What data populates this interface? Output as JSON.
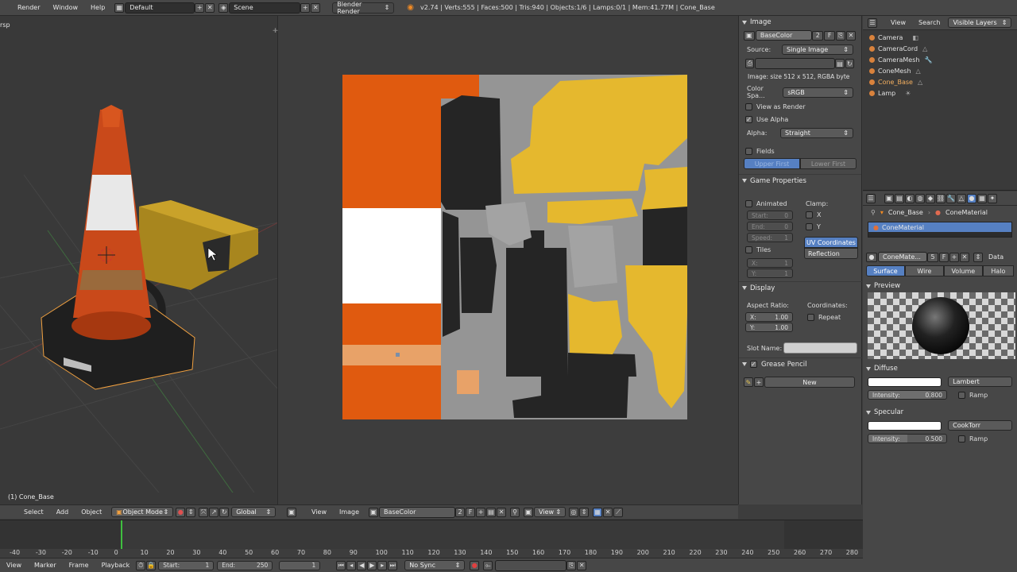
{
  "topbar": {
    "menus": [
      "Render",
      "Window",
      "Help"
    ],
    "layout": "Default",
    "scene": "Scene",
    "engine": "Blender Render",
    "stats": "v2.74 | Verts:555 | Faces:500 | Tris:940 | Objects:1/6 | Lamps:0/1 | Mem:41.77M | Cone_Base"
  },
  "view3d": {
    "corner_label": "rsp",
    "object_label": "(1) Cone_Base"
  },
  "view3d_header": {
    "menus": [
      "Select",
      "Add",
      "Object"
    ],
    "mode": "Object Mode",
    "orientation": "Global"
  },
  "image_header": {
    "menus": [
      "View",
      "Image"
    ],
    "image_name": "BaseColor",
    "users": "2",
    "fake": "F",
    "view": "View"
  },
  "image_panel": {
    "title": "Image",
    "image_name": "BaseColor",
    "users": "2",
    "fake": "F",
    "source_label": "Source:",
    "source_value": "Single Image",
    "info": "Image: size 512 x 512, RGBA byte",
    "colorspace_label": "Color Spa...",
    "colorspace_value": "sRGB",
    "view_as_render": "View as Render",
    "use_alpha": "Use Alpha",
    "alpha_label": "Alpha:",
    "alpha_value": "Straight",
    "fields": "Fields",
    "upper_first": "Upper First",
    "lower_first": "Lower First"
  },
  "game_panel": {
    "title": "Game Properties",
    "animated": "Animated",
    "clamp": "Clamp:",
    "start_label": "Start:",
    "start_val": "0",
    "end_label": "End:",
    "end_val": "0",
    "speed_label": "Speed:",
    "speed_val": "1",
    "clamp_x": "X",
    "clamp_y": "Y",
    "uv_coords": "UV Coordinates",
    "reflection": "Reflection",
    "tiles": "Tiles",
    "tx_label": "X:",
    "tx_val": "1",
    "ty_label": "Y:",
    "ty_val": "1"
  },
  "display_panel": {
    "title": "Display",
    "aspect_label": "Aspect Ratio:",
    "coords_label": "Coordinates:",
    "ax_label": "X:",
    "ax_val": "1.00",
    "ay_label": "Y:",
    "ay_val": "1.00",
    "repeat": "Repeat",
    "slot_label": "Slot Name:"
  },
  "grease_panel": {
    "title": "Grease Pencil",
    "new_label": "New"
  },
  "outliner": {
    "view": "View",
    "search": "Search",
    "layers": "Visible Layers",
    "items": [
      "Camera",
      "CameraCord",
      "CameraMesh",
      "ConeMesh",
      "Cone_Base",
      "Lamp"
    ]
  },
  "props": {
    "breadcrumb_obj": "Cone_Base",
    "breadcrumb_mat": "ConeMaterial",
    "slot_name": "ConeMaterial",
    "mat_name": "ConeMate...",
    "mat_users": "5",
    "mat_fake": "F",
    "data_label": "Data",
    "tabs": [
      "Surface",
      "Wire",
      "Volume",
      "Halo"
    ],
    "preview_title": "Preview",
    "diffuse_title": "Diffuse",
    "diffuse_shader": "Lambert",
    "diffuse_intensity_label": "Intensity:",
    "diffuse_intensity": "0.800",
    "ramp": "Ramp",
    "specular_title": "Specular",
    "specular_shader": "CookTorr",
    "specular_intensity_label": "Intensity:",
    "specular_intensity": "0.500"
  },
  "timeline": {
    "menus": [
      "View",
      "Marker",
      "Frame",
      "Playback"
    ],
    "ticks": [
      "-40",
      "-30",
      "-20",
      "-10",
      "0",
      "10",
      "20",
      "30",
      "40",
      "50",
      "60",
      "70",
      "80",
      "90",
      "100",
      "110",
      "120",
      "130",
      "140",
      "150",
      "160",
      "170",
      "180",
      "190",
      "200",
      "210",
      "220",
      "230",
      "240",
      "250",
      "260",
      "270",
      "280"
    ],
    "start_label": "Start:",
    "start_val": "1",
    "end_label": "End:",
    "end_val": "250",
    "current": "1",
    "sync": "No Sync"
  },
  "colors": {
    "orange": "#e05a0f",
    "yellow": "#e5b82e",
    "grey": "#959595",
    "dark": "#252525",
    "accent_blue": "#5680c2"
  }
}
